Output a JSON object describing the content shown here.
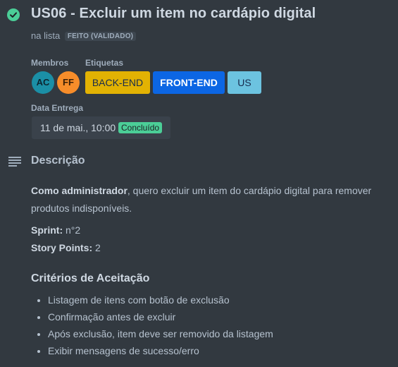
{
  "card": {
    "title": "US06 - Excluir um item no cardápio digital",
    "list_prefix": "na lista",
    "list_name": "FEITO (VALIDADO)"
  },
  "members": {
    "label": "Membros",
    "items": [
      {
        "initials": "AC",
        "color": "#1b8fa6"
      },
      {
        "initials": "FF",
        "color": "#f78d2a"
      }
    ]
  },
  "labels": {
    "label": "Etiquetas",
    "items": [
      {
        "text": "BACK-END",
        "color": "#e2b203"
      },
      {
        "text": "FRONT-END",
        "color": "#0c66e4"
      },
      {
        "text": "US",
        "color": "#6cc3e0"
      }
    ]
  },
  "due": {
    "label": "Data Entrega",
    "date": "11 de mai., 10:00",
    "status": "Concluído",
    "status_color": "#4bce97"
  },
  "description": {
    "heading": "Descrição",
    "role_bold": "Como administrador",
    "body": ", quero excluir um item do cardápio digital para remover produtos indisponíveis.",
    "sprint_label": "Sprint:",
    "sprint_value": " n°2",
    "points_label": "Story Points:",
    "points_value": " 2"
  },
  "criteria": {
    "heading": "Critérios de Aceitação",
    "items": [
      "Listagem de itens com botão de exclusão",
      "Confirmação antes de excluir",
      "Após exclusão, item deve ser removido da listagem",
      "Exibir mensagens de sucesso/erro"
    ]
  },
  "icons": {
    "status": "check-circle-icon",
    "description": "description-lines-icon"
  },
  "colors": {
    "background": "#323940",
    "status_check": "#4bce97"
  }
}
